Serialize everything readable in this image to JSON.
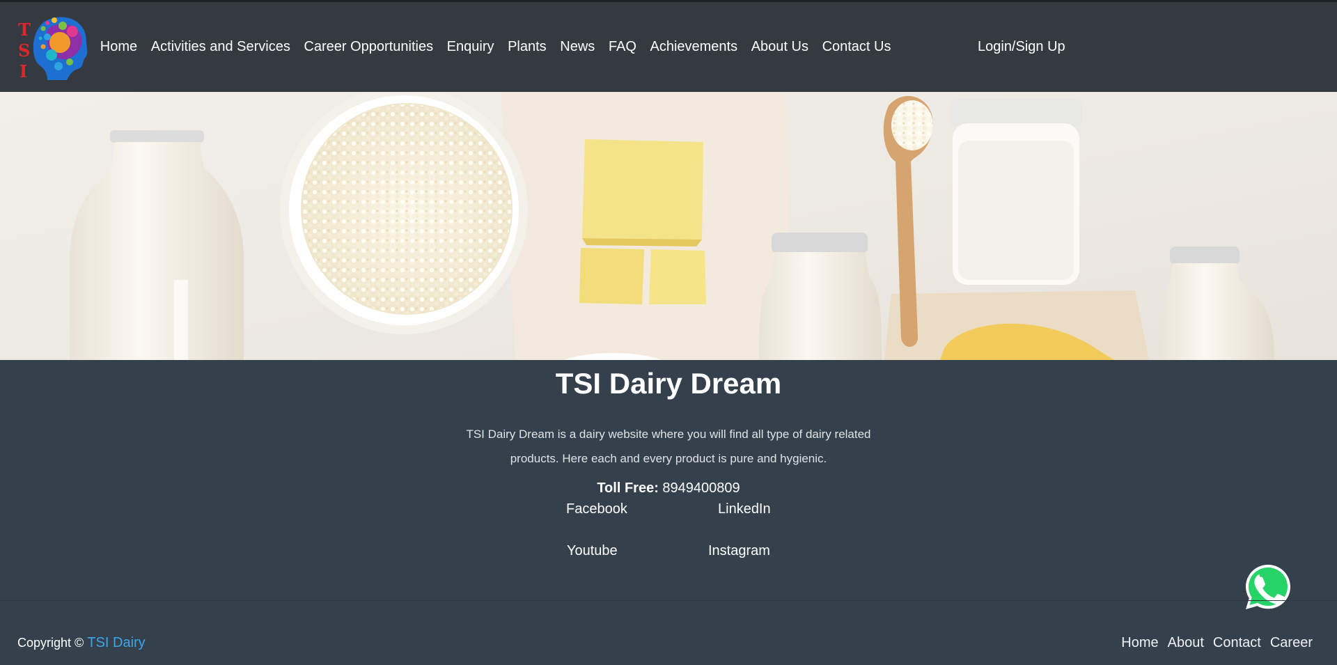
{
  "nav": {
    "logo_letters": [
      "T",
      "S",
      "I"
    ],
    "links": [
      "Home",
      "Activities and Services",
      "Career Opportunities",
      "Enquiry",
      "Plants",
      "News",
      "FAQ",
      "Achievements",
      "About Us",
      "Contact Us"
    ],
    "login": "Login/Sign Up"
  },
  "main": {
    "title": "TSI Dairy Dream",
    "description": "TSI Dairy Dream is a dairy website where you will find all type of dairy related products. Here each and every product is pure and hygienic.",
    "toll_free_label": "Toll Free:",
    "toll_free_number": "8949400809",
    "social": {
      "facebook": "Facebook",
      "linkedin": "LinkedIn",
      "youtube": "Youtube",
      "instagram": "Instagram"
    }
  },
  "footer": {
    "copyright_prefix": "Copyright ©",
    "brand": "TSI Dairy",
    "links": [
      "Home",
      "About",
      "Contact",
      "Career"
    ]
  },
  "colors": {
    "navbar": "#343a40",
    "body": "#34404c",
    "accent": "#3aa7e8",
    "whatsapp": "#25d366"
  },
  "icons": {
    "whatsapp": "whatsapp-icon",
    "logo": "tsi-head-logo"
  }
}
